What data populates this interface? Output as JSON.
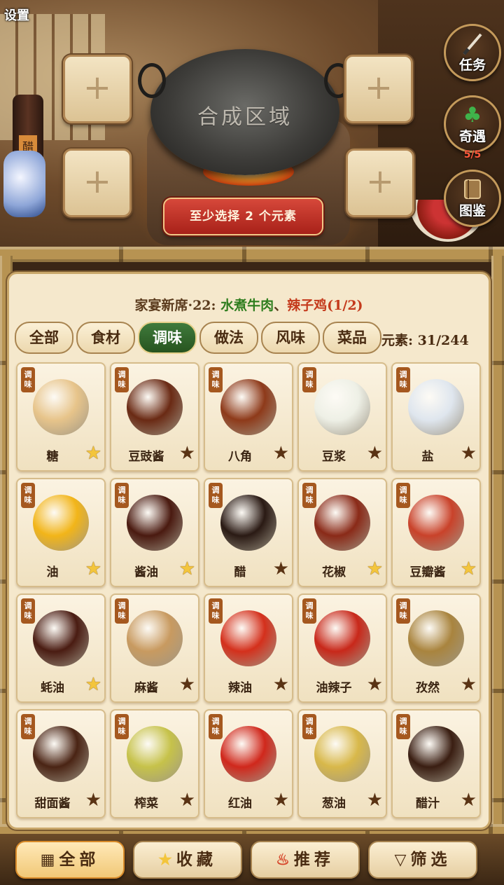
{
  "top": {
    "settings_label": "设置",
    "synthesis_area_label": "合成区域",
    "slot_plus": "+",
    "hint_banner": "至少选择 2 个元素",
    "side_buttons": {
      "task": {
        "label": "任务",
        "icon": "brush-icon"
      },
      "encounter": {
        "label": "奇遇",
        "count": "5/5",
        "icon": "clover-icon"
      },
      "codex": {
        "label": "图鉴",
        "icon": "book-icon"
      }
    }
  },
  "quest": {
    "lead": "家宴新席·22: ",
    "dish_a": "水煮牛肉",
    "sep": "、",
    "dish_b": "辣子鸡(1/2)"
  },
  "tabs": [
    "全部",
    "食材",
    "调味",
    "做法",
    "风味",
    "菜品"
  ],
  "active_tab": "调味",
  "elements_count": "元素: 31/244",
  "category_tag": "调味",
  "items": [
    {
      "name": "糖",
      "star": "gold",
      "color": "#e7c48a"
    },
    {
      "name": "豆豉酱",
      "star": "dark",
      "color": "#6a2a14"
    },
    {
      "name": "八角",
      "star": "dark",
      "color": "#8e3a1a"
    },
    {
      "name": "豆浆",
      "star": "dark",
      "color": "#eef0e6"
    },
    {
      "name": "盐",
      "star": "dark",
      "color": "#dfe6ee"
    },
    {
      "name": "油",
      "star": "gold",
      "color": "#f2b519"
    },
    {
      "name": "酱油",
      "star": "gold",
      "color": "#4a1a10"
    },
    {
      "name": "醋",
      "star": "dark",
      "color": "#2a1a14"
    },
    {
      "name": "花椒",
      "star": "gold",
      "color": "#8a2a18"
    },
    {
      "name": "豆瓣酱",
      "star": "gold",
      "color": "#c9422a"
    },
    {
      "name": "蚝油",
      "star": "gold",
      "color": "#4a1c12"
    },
    {
      "name": "麻酱",
      "star": "dark",
      "color": "#c89a60"
    },
    {
      "name": "辣油",
      "star": "dark",
      "color": "#d4301c"
    },
    {
      "name": "油辣子",
      "star": "dark",
      "color": "#c8281a"
    },
    {
      "name": "孜然",
      "star": "dark",
      "color": "#a9843e"
    },
    {
      "name": "甜面酱",
      "star": "dark",
      "color": "#4a2414"
    },
    {
      "name": "榨菜",
      "star": "dark",
      "color": "#c6c24a"
    },
    {
      "name": "红油",
      "star": "dark",
      "color": "#d0281c"
    },
    {
      "name": "葱油",
      "star": "dark",
      "color": "#d8b84a"
    },
    {
      "name": "醋汁",
      "star": "dark",
      "color": "#3a1e12"
    }
  ],
  "star_glyph": "★",
  "bottom_nav": [
    {
      "label": "全部",
      "icon": "grid-icon",
      "glyph": "▦",
      "active": true
    },
    {
      "label": "收藏",
      "icon": "star-icon",
      "glyph": "★",
      "active": false
    },
    {
      "label": "推荐",
      "icon": "flame-icon",
      "glyph": "♨",
      "active": false
    },
    {
      "label": "筛选",
      "icon": "filter-icon",
      "glyph": "▽",
      "active": false
    }
  ]
}
